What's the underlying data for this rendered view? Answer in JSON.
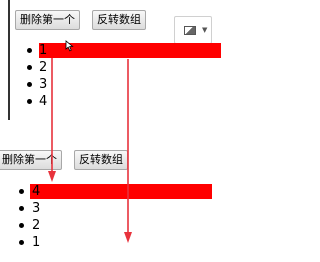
{
  "colors": {
    "highlight": "#ff0000",
    "arrow": "#e8323c"
  },
  "top_panel": {
    "delete_first_label": "删除第一个",
    "reverse_label": "反转数组",
    "image_button_icon": "image-icon",
    "items": [
      {
        "text": "1",
        "highlighted": true
      },
      {
        "text": "2",
        "highlighted": false
      },
      {
        "text": "3",
        "highlighted": false
      },
      {
        "text": "4",
        "highlighted": false
      }
    ]
  },
  "bottom_panel": {
    "delete_first_label": "删除第一个",
    "reverse_label": "反转数组",
    "items": [
      {
        "text": "4",
        "highlighted": true
      },
      {
        "text": "3",
        "highlighted": false
      },
      {
        "text": "2",
        "highlighted": false
      },
      {
        "text": "1",
        "highlighted": false
      }
    ]
  }
}
